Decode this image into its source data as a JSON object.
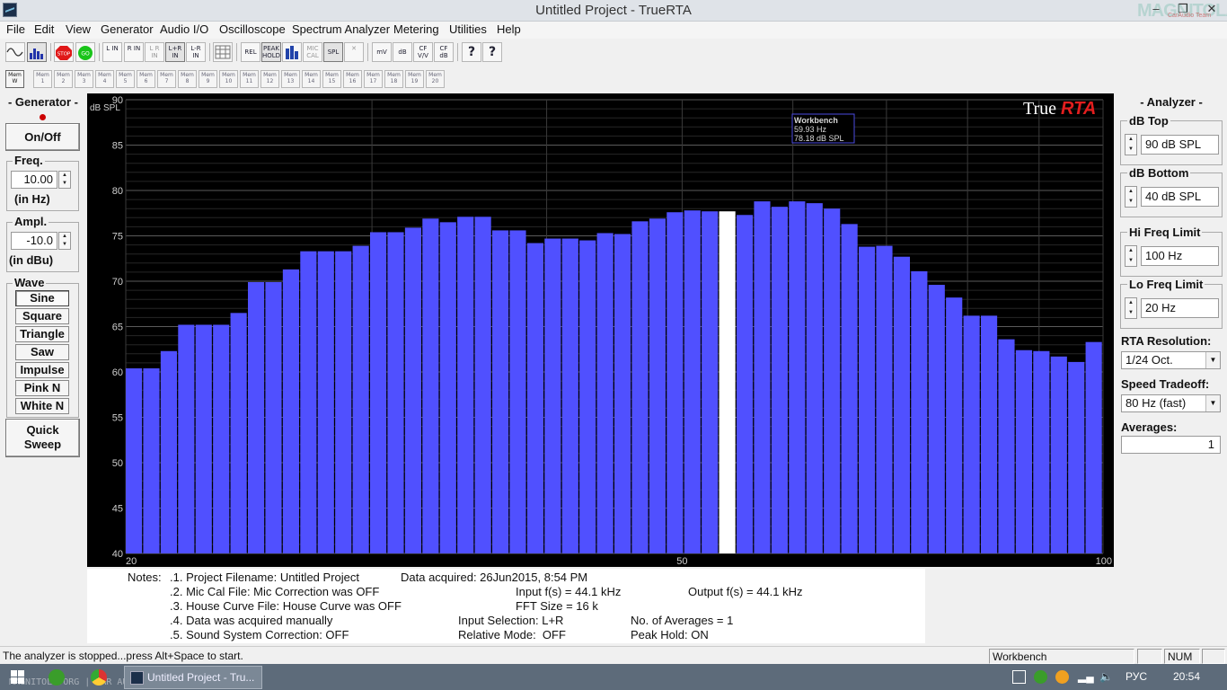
{
  "window": {
    "title": "Untitled Project - TrueRTA",
    "watermark": "MAGNITOLA",
    "watermark_sub": "CarAudio Team"
  },
  "menu": [
    "File",
    "Edit",
    "View",
    "Generator",
    "Audio I/O",
    "Oscilloscope",
    "Spectrum Analyzer",
    "Metering",
    "Utilities",
    "Help"
  ],
  "toolbar": [
    {
      "name": "sine-wave-icon",
      "label": "",
      "pressed": false
    },
    {
      "name": "rta-icon",
      "label": "",
      "pressed": true
    },
    {
      "name": "stop-button",
      "label": "STOP",
      "pressed": false
    },
    {
      "name": "go-button",
      "label": "GO",
      "pressed": false
    },
    {
      "name": "l-in-button",
      "label": "L IN",
      "pressed": false
    },
    {
      "name": "r-in-button",
      "label": "R IN",
      "pressed": false
    },
    {
      "name": "l-r-in-button",
      "label": "L R IN",
      "pressed": false
    },
    {
      "name": "lplusr-in-button",
      "label": "L+R IN",
      "pressed": true
    },
    {
      "name": "lminusr-in-button",
      "label": "L-R IN",
      "pressed": false
    },
    {
      "name": "grid-button",
      "label": "",
      "pressed": false
    },
    {
      "name": "rel-button",
      "label": "REL",
      "pressed": false
    },
    {
      "name": "peak-hold-button",
      "label": "PEAK HOLD",
      "pressed": true
    },
    {
      "name": "bars-button",
      "label": "",
      "pressed": false
    },
    {
      "name": "mic-cal-button",
      "label": "MIC CAL",
      "pressed": false
    },
    {
      "name": "spl-button",
      "label": "SPL",
      "pressed": true
    },
    {
      "name": "x-button",
      "label": "",
      "pressed": false
    },
    {
      "name": "mv-button",
      "label": "mV",
      "pressed": false
    },
    {
      "name": "db-button",
      "label": "dB",
      "pressed": false
    },
    {
      "name": "cf-vv-button",
      "label": "CF V/V",
      "pressed": false
    },
    {
      "name": "cf-db-button",
      "label": "CF dB",
      "pressed": false
    },
    {
      "name": "help-icon",
      "label": "?",
      "pressed": false
    },
    {
      "name": "context-help-icon",
      "label": "?",
      "pressed": false
    }
  ],
  "memories": [
    "Mem W",
    "Mem 1",
    "Mem 2",
    "Mem 3",
    "Mem 4",
    "Mem 5",
    "Mem 6",
    "Mem 7",
    "Mem 8",
    "Mem 9",
    "Mem 10",
    "Mem 11",
    "Mem 12",
    "Mem 13",
    "Mem 14",
    "Mem 15",
    "Mem 16",
    "Mem 17",
    "Mem 18",
    "Mem 19",
    "Mem 20"
  ],
  "generator": {
    "title": "- Generator -",
    "onoff": "On/Off",
    "freq_label": "Freq.",
    "freq_value": "10.00",
    "freq_unit": "(in Hz)",
    "ampl_label": "Ampl.",
    "ampl_value": "-10.0",
    "ampl_unit": "(in dBu)",
    "wave_label": "Wave",
    "waves": [
      "Sine",
      "Square",
      "Triangle",
      "Saw",
      "Impulse",
      "Pink N",
      "White N"
    ],
    "selected_wave": "Sine",
    "sweep_line1": "Quick",
    "sweep_line2": "Sweep"
  },
  "analyzer": {
    "title": "- Analyzer -",
    "db_top_label": "dB Top",
    "db_top": "90 dB SPL",
    "db_bottom_label": "dB Bottom",
    "db_bottom": "40 dB SPL",
    "hi_freq_label": "Hi Freq Limit",
    "hi_freq": "100 Hz",
    "lo_freq_label": "Lo Freq Limit",
    "lo_freq": "20 Hz",
    "resolution_label": "RTA Resolution:",
    "resolution": "1/24 Oct.",
    "speed_label": "Speed Tradeoff:",
    "speed": "80 Hz (fast)",
    "averages_label": "Averages:",
    "averages": "1"
  },
  "graph": {
    "brand_true": "True",
    "brand_rta": "RTA",
    "unit_label": "dB SPL",
    "bar_color": "#5050ff",
    "highlight_color": "#ffffff",
    "cursor_title": "Workbench",
    "cursor_freq": "59.93 Hz",
    "cursor_level": "78.18 dB SPL"
  },
  "chart_data": {
    "type": "bar",
    "x_scale": "log",
    "xlim": [
      20,
      100
    ],
    "ylim": [
      40,
      90
    ],
    "x_ticks": [
      "20",
      "50",
      "100"
    ],
    "y_ticks": [
      "40",
      "45",
      "50",
      "55",
      "60",
      "65",
      "70",
      "75",
      "80",
      "85",
      "90"
    ],
    "ylabel": "dB SPL",
    "grid": true,
    "highlighted_index": 34,
    "values": [
      60.4,
      60.4,
      62.3,
      65.2,
      65.2,
      65.2,
      66.5,
      69.9,
      69.9,
      71.3,
      73.3,
      73.3,
      73.3,
      73.9,
      75.4,
      75.4,
      75.9,
      76.9,
      76.5,
      77.1,
      77.1,
      75.6,
      75.6,
      74.2,
      74.7,
      74.7,
      74.5,
      75.3,
      75.2,
      76.6,
      76.9,
      77.6,
      77.8,
      77.7,
      77.7,
      77.3,
      78.8,
      78.2,
      78.8,
      78.6,
      78.0,
      76.3,
      73.8,
      73.9,
      72.7,
      71.1,
      69.6,
      68.2,
      66.2,
      66.2,
      63.6,
      62.4,
      62.3,
      61.7,
      61.1,
      63.3
    ]
  },
  "notes": {
    "label": "Notes:",
    "line1": ".1. Project Filename: Untitled Project",
    "data_acquired": "Data acquired: 26Jun2015, 8:54 PM",
    "line2": ".2. Mic Cal File: Mic Correction was OFF",
    "input_fs": "Input f(s) = 44.1 kHz",
    "output_fs": "Output f(s) = 44.1 kHz",
    "line3": ".3. House Curve File: House Curve was OFF",
    "fft_size": "FFT Size = 16 k",
    "line4": ".4. Data was acquired manually",
    "input_selection": "Input Selection: L+R",
    "num_averages": "No. of Averages = 1",
    "line5": ".5. Sound System Correction: OFF",
    "relative_mode": "Relative Mode:  OFF",
    "peak_hold": "Peak Hold: ON"
  },
  "status": {
    "message": "The analyzer is stopped...press Alt+Space to start.",
    "panel_name": "Workbench",
    "num": "NUM"
  },
  "taskbar": {
    "app_label": "Untitled Project - Tru...",
    "lang": "РУС",
    "time": "20:54",
    "watermark": "MAGNITOLA.ORG | CAR AUDIO"
  }
}
